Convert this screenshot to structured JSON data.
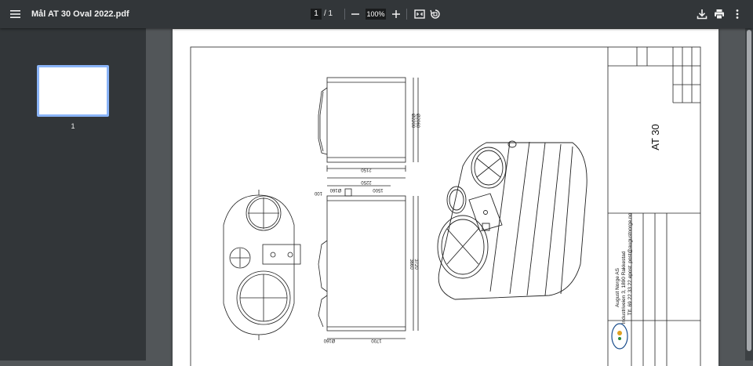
{
  "toolbar": {
    "title": "Mål AT 30 Oval 2022.pdf",
    "current_page": "1",
    "page_separator": "/  1",
    "zoom": "100%",
    "icons": [
      "menu-icon",
      "zoom-out-icon",
      "zoom-in-icon",
      "fit-page-icon",
      "rotate-icon",
      "download-icon",
      "print-icon",
      "more-vert-icon"
    ]
  },
  "sidebar": {
    "thumbnails": [
      {
        "label": "1"
      }
    ]
  },
  "drawing": {
    "title": "AT 30",
    "company": "August Norge AS",
    "address": "Industriveien 3, 1890 Rakkestad",
    "contact": "Tlf. 69 22 33 22  epost: post@augustnorge.no",
    "dims": {
      "d2200": "Ø2200",
      "d2060": "Ø2060",
      "w2150": "2150",
      "w2250": "2250",
      "w1500": "1500",
      "d160_top": "Ø160",
      "h100": "100",
      "h3660": "3660",
      "h3720": "3720",
      "w1700": "1700",
      "d160_bottom": "Ø160"
    }
  }
}
